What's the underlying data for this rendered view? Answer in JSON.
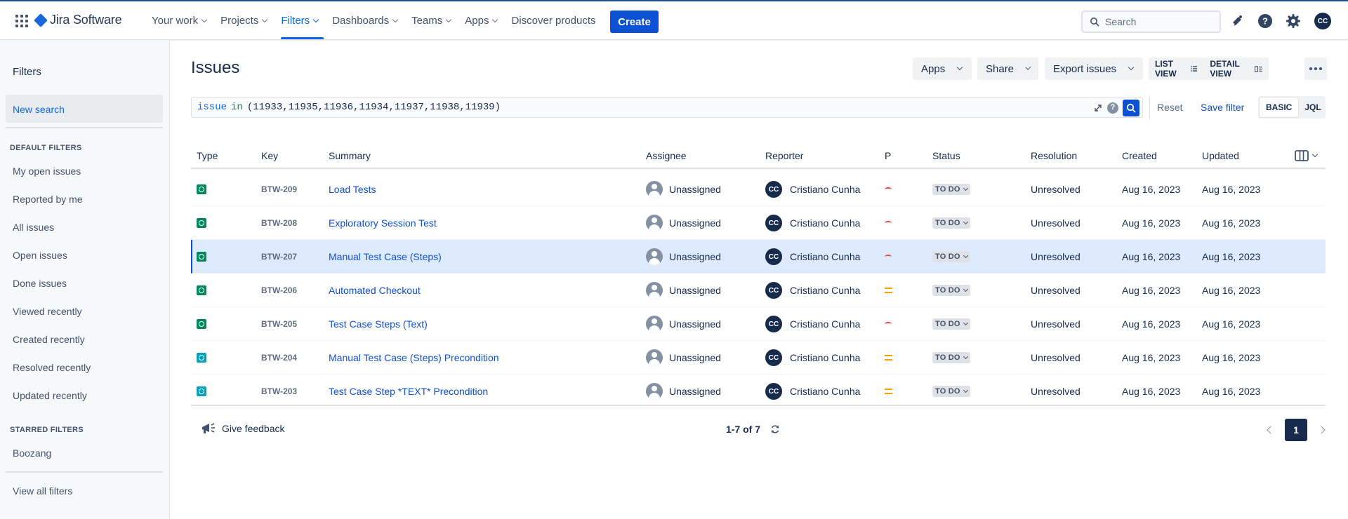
{
  "topnav": {
    "product_name": "Jira Software",
    "items": [
      {
        "label": "Your work"
      },
      {
        "label": "Projects"
      },
      {
        "label": "Filters",
        "active": true
      },
      {
        "label": "Dashboards"
      },
      {
        "label": "Teams"
      },
      {
        "label": "Apps"
      }
    ],
    "discover_label": "Discover products",
    "create_label": "Create",
    "search_placeholder": "Search",
    "user_initials": "CC",
    "icons": [
      "app-switcher-icon",
      "notifications-icon",
      "help-icon",
      "settings-icon"
    ]
  },
  "sidebar": {
    "title": "Filters",
    "new_search": "New search",
    "default_heading": "DEFAULT FILTERS",
    "default_filters": [
      "My open issues",
      "Reported by me",
      "All issues",
      "Open issues",
      "Done issues",
      "Viewed recently",
      "Created recently",
      "Resolved recently",
      "Updated recently"
    ],
    "starred_heading": "STARRED FILTERS",
    "starred_filters": [
      "Boozang"
    ],
    "view_all": "View all filters"
  },
  "main": {
    "title": "Issues",
    "toolbar": {
      "apps_label": "Apps",
      "share_label": "Share",
      "export_label": "Export issues",
      "list_view_label": "LIST VIEW",
      "detail_view_label": "DETAIL VIEW"
    },
    "jql": {
      "keyword": "issue",
      "operator": "in",
      "values": "(11933,11935,11936,11934,11937,11938,11939)",
      "help_glyph": "?"
    },
    "reset_label": "Reset",
    "save_filter_label": "Save filter",
    "mode_basic": "BASIC",
    "mode_jql": "JQL",
    "columns": [
      "Type",
      "Key",
      "Summary",
      "Assignee",
      "Reporter",
      "P",
      "Status",
      "Resolution",
      "Created",
      "Updated"
    ],
    "rows": [
      {
        "type": "test",
        "key": "BTW-209",
        "summary": "Load Tests",
        "assignee": "Unassigned",
        "reporter_initials": "CC",
        "reporter": "Cristiano Cunha",
        "priority": "high",
        "status": "TO DO",
        "resolution": "Unresolved",
        "created": "Aug 16, 2023",
        "updated": "Aug 16, 2023"
      },
      {
        "type": "test",
        "key": "BTW-208",
        "summary": "Exploratory Session Test",
        "assignee": "Unassigned",
        "reporter_initials": "CC",
        "reporter": "Cristiano Cunha",
        "priority": "high",
        "status": "TO DO",
        "resolution": "Unresolved",
        "created": "Aug 16, 2023",
        "updated": "Aug 16, 2023"
      },
      {
        "type": "test",
        "key": "BTW-207",
        "summary": "Manual Test Case (Steps)",
        "assignee": "Unassigned",
        "reporter_initials": "CC",
        "reporter": "Cristiano Cunha",
        "priority": "high",
        "status": "TO DO",
        "resolution": "Unresolved",
        "created": "Aug 16, 2023",
        "updated": "Aug 16, 2023",
        "selected": true
      },
      {
        "type": "test",
        "key": "BTW-206",
        "summary": "Automated Checkout",
        "assignee": "Unassigned",
        "reporter_initials": "CC",
        "reporter": "Cristiano Cunha",
        "priority": "medium",
        "status": "TO DO",
        "resolution": "Unresolved",
        "created": "Aug 16, 2023",
        "updated": "Aug 16, 2023"
      },
      {
        "type": "test",
        "key": "BTW-205",
        "summary": "Test Case Steps (Text)",
        "assignee": "Unassigned",
        "reporter_initials": "CC",
        "reporter": "Cristiano Cunha",
        "priority": "high",
        "status": "TO DO",
        "resolution": "Unresolved",
        "created": "Aug 16, 2023",
        "updated": "Aug 16, 2023"
      },
      {
        "type": "precondition",
        "key": "BTW-204",
        "summary": "Manual Test Case (Steps) Precondition",
        "assignee": "Unassigned",
        "reporter_initials": "CC",
        "reporter": "Cristiano Cunha",
        "priority": "medium",
        "status": "TO DO",
        "resolution": "Unresolved",
        "created": "Aug 16, 2023",
        "updated": "Aug 16, 2023"
      },
      {
        "type": "precondition",
        "key": "BTW-203",
        "summary": "Test Case Step *TEXT* Precondition",
        "assignee": "Unassigned",
        "reporter_initials": "CC",
        "reporter": "Cristiano Cunha",
        "priority": "medium",
        "status": "TO DO",
        "resolution": "Unresolved",
        "created": "Aug 16, 2023",
        "updated": "Aug 16, 2023"
      }
    ],
    "feedback_label": "Give feedback",
    "page_count": "1-7 of 7",
    "current_page": "1"
  }
}
